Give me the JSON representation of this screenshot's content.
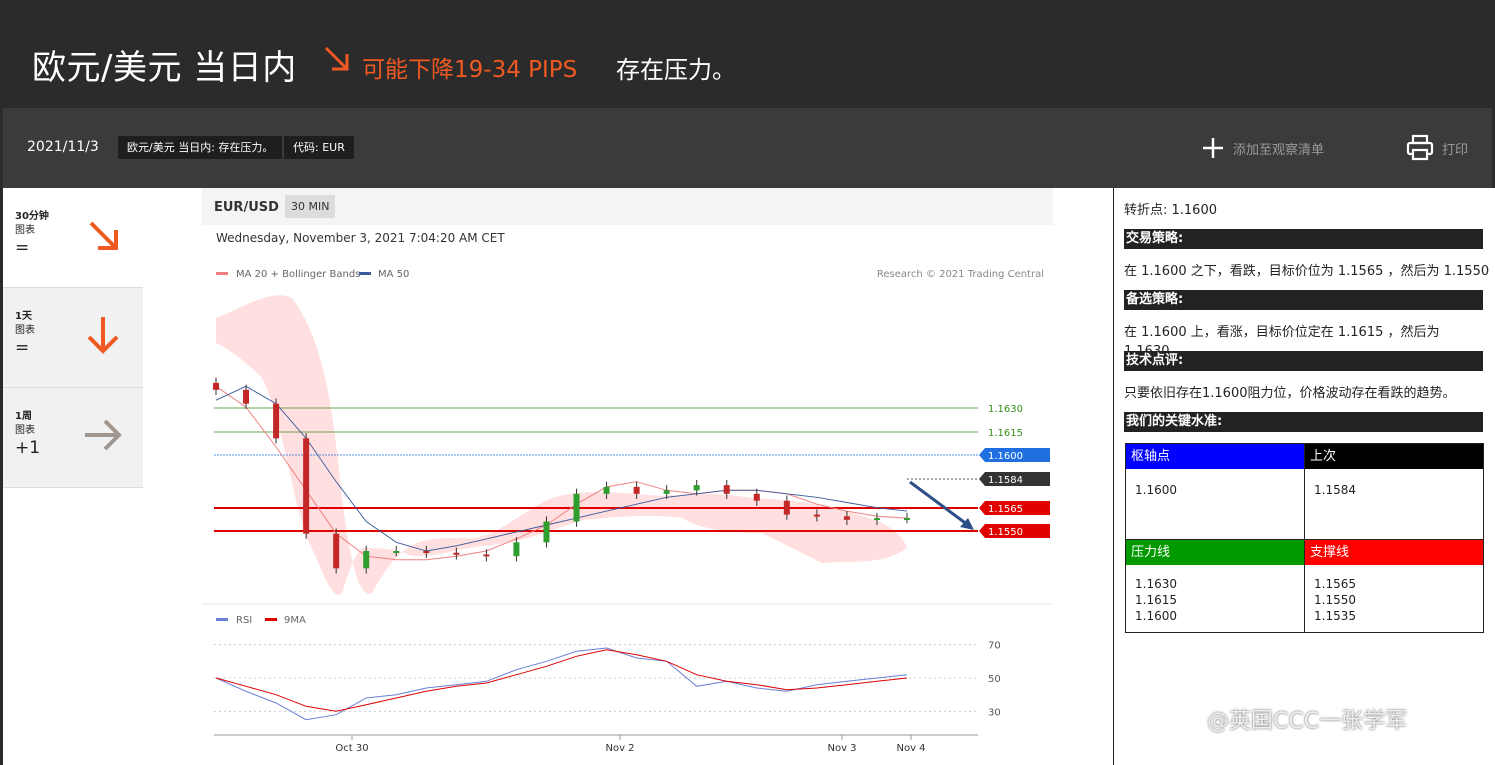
{
  "header": {
    "title": "欧元/美元 当日内",
    "forecast": "可能下降19-34 PIPS",
    "pressure": "存在压力。"
  },
  "toolbar": {
    "date": "2021/11/3",
    "tag_title": "欧元/美元 当日内: 存在压力。",
    "tag_code": "代码: EUR",
    "add_watchlist": "添加至观察清单",
    "print": "打印"
  },
  "timeframes": [
    {
      "label": "30分钟",
      "sub": "图表",
      "sign": "=",
      "icon": "arrow-down-right-icon",
      "color": "#f05a22"
    },
    {
      "label": "1天",
      "sub": "图表",
      "sign": "=",
      "icon": "arrow-down-icon",
      "color": "#f05a22"
    },
    {
      "label": "1周",
      "sub": "图表",
      "sign": "+1",
      "icon": "arrow-right-icon",
      "color": "#a09890"
    }
  ],
  "chart": {
    "symbol": "EUR/USD",
    "timeframe": "30 MIN",
    "timestamp": "Wednesday, November 3, 2021 7:04:20 AM CET",
    "legend_ma20": "MA 20 + Bollinger Bands",
    "legend_ma50": "MA 50",
    "copyright": "Research © 2021 Trading Central",
    "rsi_legend": "RSI",
    "rsi_ma_legend": "9MA",
    "colors": {
      "ma20": "#f08080",
      "ma50": "#3b5b9a",
      "support": "#e00000",
      "resistance": "#3a8f1a",
      "pivot": "#1f6fe0"
    }
  },
  "chart_data": [
    {
      "type": "line",
      "title": "",
      "xlabel": "",
      "ylabel": "",
      "x_ticks": [
        "Oct 30",
        "Nov 2",
        "Nov 3",
        "Nov 4"
      ],
      "ylim": [
        1.1535,
        1.1685
      ],
      "price_levels": [
        {
          "label": "1.1630",
          "value": 1.163,
          "kind": "resistance"
        },
        {
          "label": "1.1615",
          "value": 1.1615,
          "kind": "resistance"
        },
        {
          "label": "1.1600",
          "value": 1.16,
          "kind": "pivot"
        },
        {
          "label": "1.1584",
          "value": 1.1584,
          "kind": "last"
        },
        {
          "label": "1.1565",
          "value": 1.1565,
          "kind": "support"
        },
        {
          "label": "1.1550",
          "value": 1.155,
          "kind": "support"
        }
      ],
      "series": [
        {
          "name": "MA 20 + Bollinger Bands",
          "values": [
            1.166,
            1.1648,
            1.1625,
            1.16,
            1.1575,
            1.1562,
            1.156,
            1.156,
            1.1562,
            1.1565,
            1.1572,
            1.158,
            1.1592,
            1.1602,
            1.1605,
            1.16,
            1.1598,
            1.16,
            1.16,
            1.1598,
            1.1592,
            1.1588,
            1.1585,
            1.1584
          ]
        },
        {
          "name": "MA 50",
          "values": [
            1.1652,
            1.166,
            1.165,
            1.163,
            1.1605,
            1.1582,
            1.157,
            1.1565,
            1.1568,
            1.1572,
            1.1576,
            1.158,
            1.1584,
            1.1588,
            1.1592,
            1.1596,
            1.1598,
            1.16,
            1.16,
            1.1598,
            1.1596,
            1.1593,
            1.159,
            1.1588
          ]
        }
      ],
      "price_close": [
        1.1658,
        1.165,
        1.163,
        1.1575,
        1.1555,
        1.1565,
        1.1565,
        1.1564,
        1.1563,
        1.1562,
        1.157,
        1.1582,
        1.1598,
        1.1602,
        1.1598,
        1.16,
        1.1603,
        1.1598,
        1.1594,
        1.1586,
        1.1585,
        1.1583,
        1.1584,
        1.1584
      ]
    },
    {
      "type": "line",
      "title": "",
      "xlabel": "",
      "ylabel": "",
      "ylim": [
        20,
        80
      ],
      "y_ticks": [
        30,
        50,
        70
      ],
      "series": [
        {
          "name": "RSI",
          "values": [
            50,
            42,
            35,
            25,
            28,
            38,
            40,
            44,
            46,
            48,
            55,
            60,
            66,
            68,
            62,
            60,
            45,
            48,
            44,
            42,
            46,
            48,
            50,
            52
          ]
        },
        {
          "name": "9MA",
          "values": [
            50,
            45,
            40,
            33,
            30,
            34,
            38,
            42,
            45,
            47,
            52,
            57,
            63,
            67,
            64,
            60,
            52,
            48,
            46,
            43,
            44,
            46,
            48,
            50
          ]
        }
      ]
    }
  ],
  "right": {
    "pivot_line": "转折点: 1.1600",
    "strategy_head": "交易策略:",
    "strategy_text": "在 1.1600 之下，看跌，目标价位为 1.1565 ，然后为 1.1550 。",
    "alt_head": "备选策略:",
    "alt_text": "在 1.1600 上，看涨，目标价位定在 1.1615 ，然后为 1.1630。",
    "tech_head": "技术点评:",
    "tech_text": "只要依旧存在1.1600阻力位，价格波动存在看跌的趋势。",
    "levels_head": "我们的关键水准:",
    "pivot_head": "枢轴点",
    "last_head": "上次",
    "pivot_value": "1.1600",
    "last_value": "1.1584",
    "resistance_head": "压力线",
    "support_head": "支撑线",
    "resistance": [
      "1.1630",
      "1.1615",
      "1.1600"
    ],
    "support": [
      "1.1565",
      "1.1550",
      "1.1535"
    ],
    "colors": {
      "pivot": "#0000ff",
      "last": "#000000",
      "resistance": "#009900",
      "support": "#ff0000"
    }
  },
  "watermark": "@英国CCC一张学军"
}
